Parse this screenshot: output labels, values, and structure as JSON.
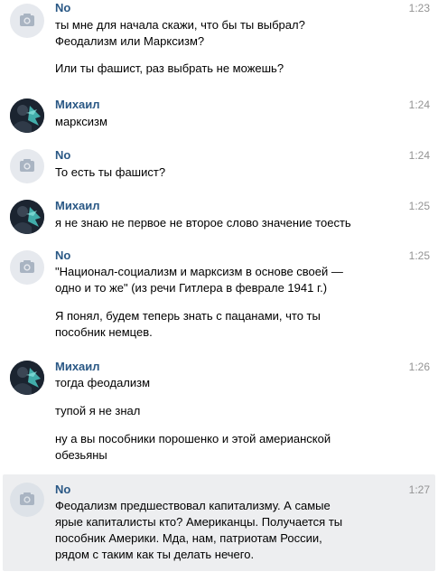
{
  "messages": [
    {
      "author": "No",
      "time": "1:23",
      "avatar": "camera-icon",
      "paragraphs": [
        [
          "ты мне для начала скажи, что бы ты выбрал?",
          "Феодализм или Марксизм?"
        ],
        [
          "Или ты фашист, раз выбрать не можешь?"
        ]
      ]
    },
    {
      "author": "Михаил",
      "time": "1:24",
      "avatar": "photo",
      "paragraphs": [
        [
          "марксизм"
        ]
      ]
    },
    {
      "author": "No",
      "time": "1:24",
      "avatar": "camera-icon",
      "paragraphs": [
        [
          "То есть ты фашист?"
        ]
      ]
    },
    {
      "author": "Михаил",
      "time": "1:25",
      "avatar": "photo",
      "paragraphs": [
        [
          "я не знаю не первое не второе слово значение тоесть"
        ]
      ]
    },
    {
      "author": "No",
      "time": "1:25",
      "avatar": "camera-icon",
      "paragraphs": [
        [
          "\"Национал-социализм и марксизм в основе своей —",
          "одно и то же\" (из речи Гитлера в феврале 1941 г.)"
        ],
        [
          "Я понял, будем теперь знать с пацанами, что ты",
          "пособник немцев."
        ]
      ]
    },
    {
      "author": "Михаил",
      "time": "1:26",
      "avatar": "photo",
      "paragraphs": [
        [
          "тогда феодализм"
        ],
        [
          "тупой я не знал"
        ],
        [
          "ну а вы пособники порошенко и этой америанской",
          "обезьяны"
        ]
      ]
    },
    {
      "author": "No",
      "time": "1:27",
      "avatar": "camera-icon",
      "highlighted": true,
      "paragraphs": [
        [
          "Феодализм предшествовал капитализму. А самые",
          "ярые капиталисты кто? Американцы. Получается ты",
          "пособник Америки. Мда, нам, патриотам России,",
          "рядом с таким как ты делать нечего."
        ]
      ]
    }
  ]
}
